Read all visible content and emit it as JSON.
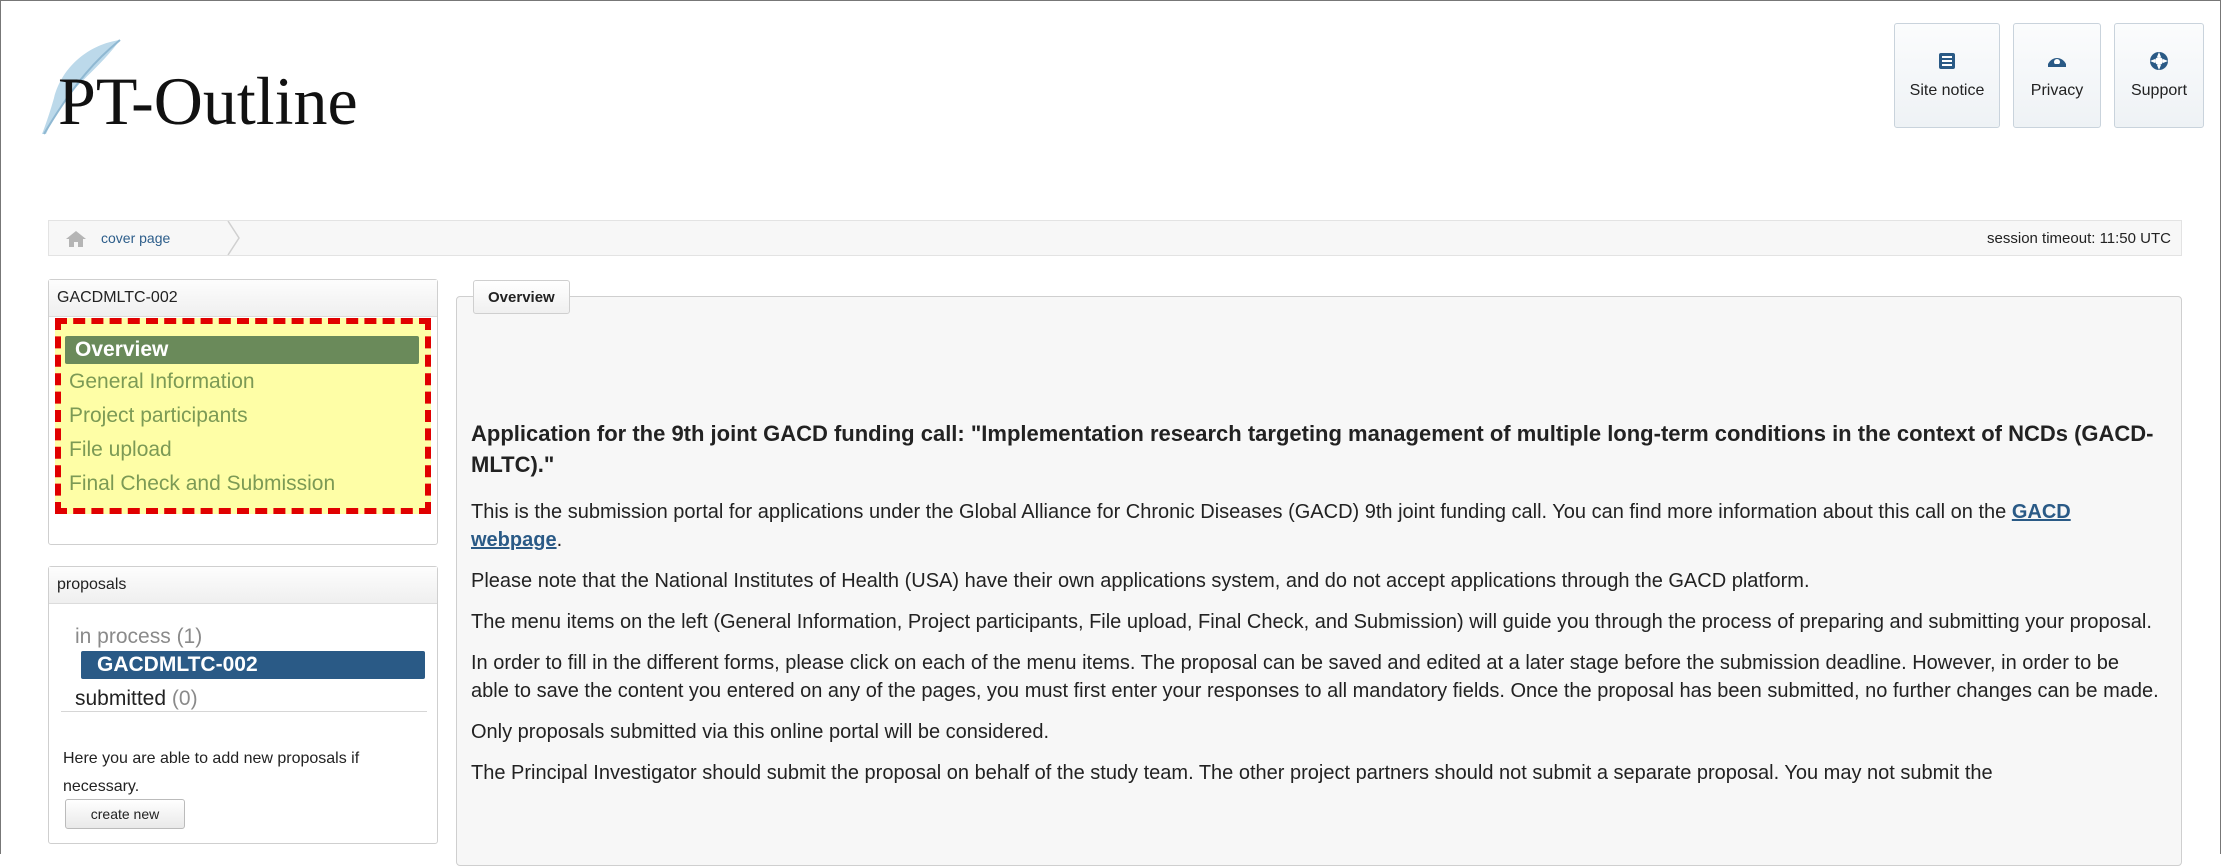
{
  "app": {
    "logo_text": "PT-Outline"
  },
  "header_buttons": [
    {
      "label": "Site notice",
      "icon": "building-icon"
    },
    {
      "label": "Privacy",
      "icon": "eye-icon"
    },
    {
      "label": "Support",
      "icon": "lifebuoy-icon"
    }
  ],
  "breadcrumb": {
    "items": [
      "cover page"
    ],
    "session_timeout": "session timeout: 11:50 UTC"
  },
  "menu_panel": {
    "title": "GACDMLTC-002",
    "items": [
      {
        "label": "Overview",
        "active": true
      },
      {
        "label": "General Information",
        "active": false
      },
      {
        "label": "Project participants",
        "active": false
      },
      {
        "label": "File upload",
        "active": false
      },
      {
        "label": "Final Check and Submission",
        "active": false
      }
    ]
  },
  "proposals_panel": {
    "title": "proposals",
    "in_process_label": "in process",
    "in_process_count": "(1)",
    "active_proposal": "GACDMLTC-002",
    "submitted_label": "submitted",
    "submitted_count": "(0)",
    "help_text": "Here you are able to add new proposals if necessary.",
    "create_button": "create new"
  },
  "main": {
    "legend": "Overview",
    "heading": "Application for the 9th joint GACD funding call: \"Implementation research targeting management of multiple long-term conditions in the context of NCDs (GACD-MLTC).\"",
    "p1_before": "This is the submission portal for applications under the Global Alliance for Chronic Diseases (GACD) 9th joint funding call. You can find more information about this call on the ",
    "p1_link": "GACD webpage",
    "p1_after": ".",
    "p2": "Please note that the National Institutes of Health (USA) have their own applications system, and do not accept applications through the GACD platform.",
    "p3": "The menu items on the left (General Information, Project participants, File upload, Final Check, and Submission) will guide you through the process of preparing and submitting your proposal.",
    "p4": "In order to fill in the different forms, please click on each of the menu items. The proposal can be saved and edited at a later stage before the submission deadline. However, in order to be able to save the content you entered on any of the pages, you must first enter your responses to all mandatory fields. Once the proposal has been submitted, no further changes can be made.",
    "p5": "Only proposals submitted via this online portal will be considered.",
    "p6": "The Principal Investigator should submit the proposal on behalf of the study team. The other project partners should not submit a separate proposal. You may not submit the"
  },
  "colors": {
    "menu_highlight_bg": "#fefea6",
    "menu_highlight_border": "#e00000",
    "active_menu_bg": "#6a8a5a",
    "menu_text": "#7c9a55",
    "active_proposal_bg": "#2a5a86",
    "link": "#2a5a86"
  }
}
